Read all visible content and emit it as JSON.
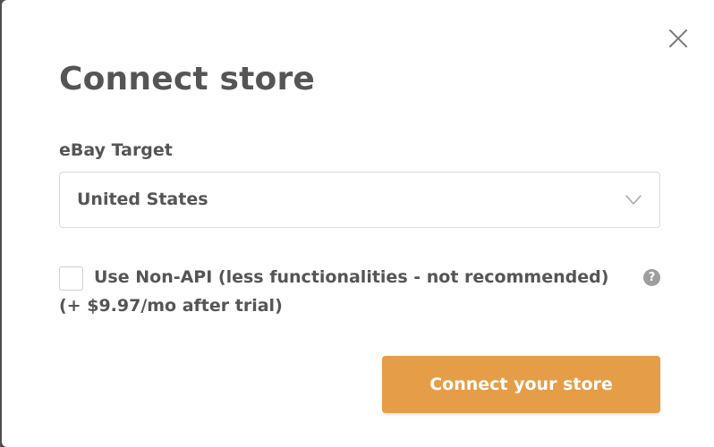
{
  "modal": {
    "title": "Connect store",
    "close_icon": "close-icon"
  },
  "form": {
    "target_label": "eBay Target",
    "target_selected": "United States",
    "dropdown_icon": "chevron-down-icon",
    "non_api_checked": false,
    "non_api_label": "Use Non-API (less functionalities - not recommended)",
    "non_api_price_note": "(+ $9.97/mo after trial)",
    "help_icon": "question-mark-icon",
    "help_glyph": "?"
  },
  "actions": {
    "connect_label": "Connect your store"
  },
  "colors": {
    "accent": "#e59e47",
    "text": "#555555",
    "border": "#dcdcdc",
    "backdrop": "#4f4f4f",
    "help_icon_bg": "#9e9e9e"
  }
}
